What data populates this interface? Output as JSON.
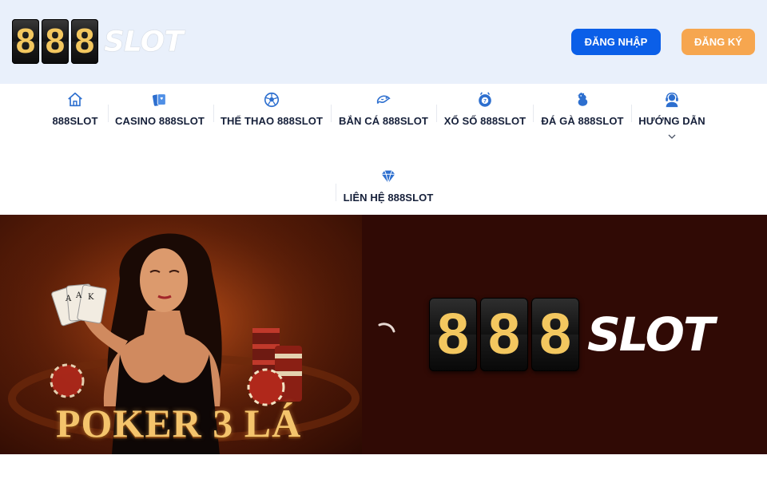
{
  "header": {
    "logo_digits": [
      "8",
      "8",
      "8"
    ],
    "logo_word": "SLOT",
    "login_label": "ĐĂNG NHẬP",
    "register_label": "ĐĂNG KÝ"
  },
  "nav": {
    "items": [
      {
        "label": "888SLOT",
        "icon": "home-icon"
      },
      {
        "label": "CASINO 888SLOT",
        "icon": "cards-icon"
      },
      {
        "label": "THỂ THAO 888SLOT",
        "icon": "soccer-ball-icon"
      },
      {
        "label": "BẮN CÁ 888SLOT",
        "icon": "fish-icon"
      },
      {
        "label": "XỔ SỐ 888SLOT",
        "icon": "lottery-ball-icon"
      },
      {
        "label": "ĐÁ GÀ 888SLOT",
        "icon": "rooster-icon"
      },
      {
        "label": "HƯỚNG DẪN",
        "icon": "support-agent-icon"
      },
      {
        "label": "LIÊN HỆ 888SLOT",
        "icon": "diamond-icon"
      }
    ]
  },
  "banner": {
    "poker_title": "POKER 3 LÁ",
    "brand_digits": [
      "8",
      "8",
      "8"
    ],
    "brand_word": "SLOT"
  },
  "colors": {
    "header_bg": "#e9f0fb",
    "login_button": "#0b5fe8",
    "register_button": "#f6a64f",
    "nav_icon": "#2d6fcf",
    "banner_bg": "#300a05",
    "gold": "#f3c75f"
  }
}
